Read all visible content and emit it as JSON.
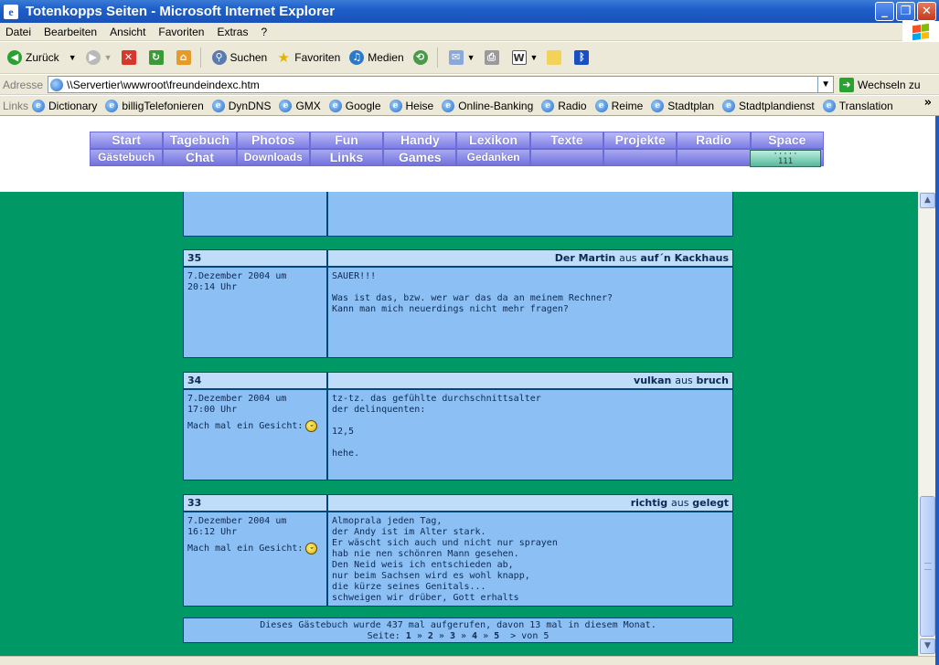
{
  "window": {
    "title": "Totenkopps Seiten - Microsoft Internet Explorer"
  },
  "menu": [
    "Datei",
    "Bearbeiten",
    "Ansicht",
    "Favoriten",
    "Extras",
    "?"
  ],
  "toolbar": {
    "back": "Zurück",
    "search": "Suchen",
    "favorites": "Favoriten",
    "media": "Medien"
  },
  "address": {
    "label": "Adresse",
    "url": "\\\\Servertier\\wwwroot\\freundeindexc.htm",
    "go": "Wechseln zu"
  },
  "links": {
    "label": "Links",
    "items": [
      "Dictionary",
      "billigTelefonieren",
      "DynDNS",
      "GMX",
      "Google",
      "Heise",
      "Online-Banking",
      "Radio",
      "Reime",
      "Stadtplan",
      "Stadtplandienst",
      "Translation"
    ]
  },
  "nav": {
    "row1": [
      "Start",
      "Tagebuch",
      "Photos",
      "Fun",
      "Handy",
      "Lexikon",
      "Texte",
      "Projekte",
      "Radio",
      "Space"
    ],
    "row2": [
      "Gästebuch",
      "Chat",
      "Downloads",
      "Links",
      "Games",
      "Gedanken"
    ],
    "counter": "111"
  },
  "entries": [
    {
      "num": "35",
      "name": "Der Martin",
      "aus": "aus",
      "place": "auf´n Kackhaus",
      "date": "7.Dezember 2004 um\n20:14 Uhr",
      "face": "",
      "text": "SAUER!!!\n\nWas ist das, bzw. wer war das da an meinem Rechner?\nKann man mich neuerdings nicht mehr fragen?"
    },
    {
      "num": "34",
      "name": "vulkan",
      "aus": "aus",
      "place": "bruch",
      "date": "7.Dezember 2004 um\n17:00 Uhr",
      "face": "Mach mal ein Gesicht:",
      "text": "tz-tz. das gefühlte durchschnittsalter\nder delinquenten:\n\n12,5\n\nhehe."
    },
    {
      "num": "33",
      "name": "richtig",
      "aus": "aus",
      "place": "gelegt",
      "date": "7.Dezember 2004 um\n16:12 Uhr",
      "face": "Mach mal ein Gesicht:",
      "text": "Almoprala jeden Tag,\nder Andy ist im Alter stark.\nEr wäscht sich auch und nicht nur sprayen\nhab nie nen schönren Mann gesehen.\nDen Neid weis ich entschieden ab,\nnur beim Sachsen wird es wohl knapp,\ndie kürze seines Genitals...\nschweigen wir drüber, Gott erhalts"
    }
  ],
  "footer": {
    "line1": "Dieses Gästebuch wurde 437 mal aufgerufen, davon 13 mal in diesem Monat.",
    "seite": "Seite:",
    "pages": [
      "1",
      "2",
      "3",
      "4",
      "5"
    ],
    "next": ">",
    "von": "von 5"
  }
}
